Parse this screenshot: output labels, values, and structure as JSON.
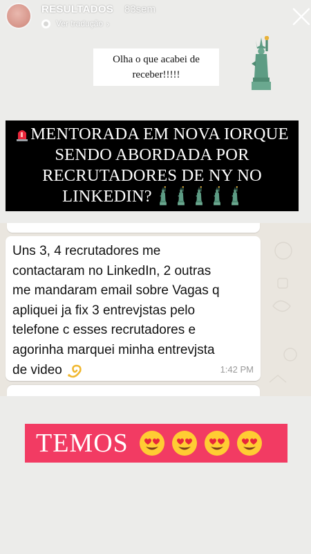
{
  "header": {
    "account_name": "RESULTADOS",
    "time_ago": "83sem",
    "translate_label": "Ver tradução",
    "translate_chevron": "›"
  },
  "caption": {
    "text": "Olha o que acabei de receber!!!!!"
  },
  "headline": {
    "text": "MENTORADA EM NOVA IORQUE SENDO ABORDADA POR RECRUTADORES DE NY NO LINKEDIN?",
    "icon_prefix": "police-siren-icon",
    "icon_suffix": "statue-of-liberty-icon",
    "suffix_icon_count": 5
  },
  "chat": {
    "message": "Uns 3, 4 recrutadores me\ncontactaram no LinkedIn, 2 outras\nme mandaram email sobre Vagas q\napliquei ja fix 3 entrevjstas pelo\ntelefone c esses recrutadores e\nagorinha marquei minha entrevjsta\nde video",
    "message_icon": "dizzy-icon",
    "time": "1:42 PM"
  },
  "banner": {
    "text": "TEMOS",
    "icon": "heart-eyes-emoji",
    "icon_count": 4
  },
  "colors": {
    "banner_bg": "#f23b63",
    "headline_bg": "#000000",
    "page_bg": "#ececea",
    "chat_bg": "#eae6df"
  }
}
